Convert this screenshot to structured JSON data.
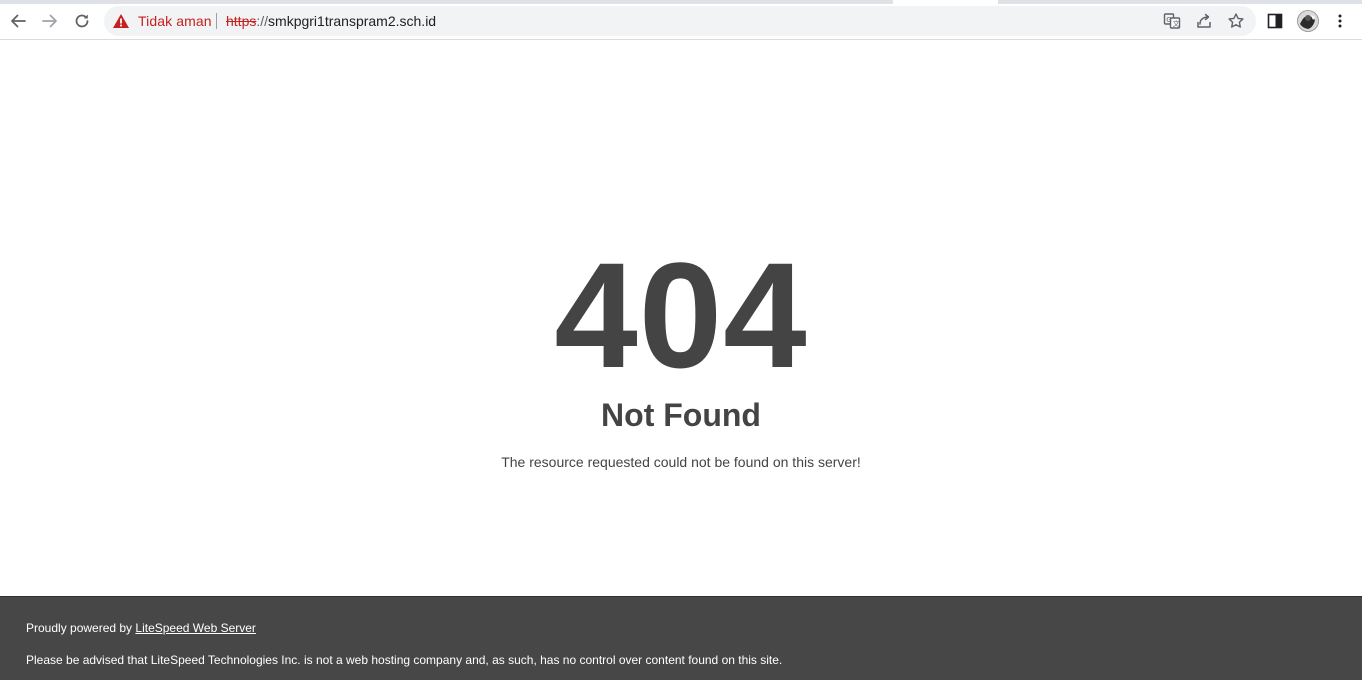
{
  "browser": {
    "security_label": "Tidak aman",
    "url_scheme": "https",
    "url_separator": "://",
    "url_host": "smkpgri1transpram2.sch.id",
    "icons": {
      "back": "arrow-left-icon",
      "forward": "arrow-right-icon",
      "reload": "reload-icon",
      "security_warning": "warning-triangle-icon",
      "translate": "translate-icon",
      "share": "share-icon",
      "bookmark": "star-icon",
      "side_panel": "side-panel-icon",
      "profile": "avatar",
      "menu": "kebab-menu-icon"
    },
    "colors": {
      "insecure": "#c5221f",
      "omnibox_bg": "#f1f3f4"
    }
  },
  "page": {
    "error_code": "404",
    "error_title": "Not Found",
    "error_description": "The resource requested could not be found on this server!",
    "text_color": "#444444"
  },
  "footer": {
    "powered_prefix": "Proudly powered by ",
    "powered_link": "LiteSpeed Web Server",
    "disclaimer": "Please be advised that LiteSpeed Technologies Inc. is not a web hosting company and, as such, has no control over content found on this site.",
    "background": "#474747"
  }
}
